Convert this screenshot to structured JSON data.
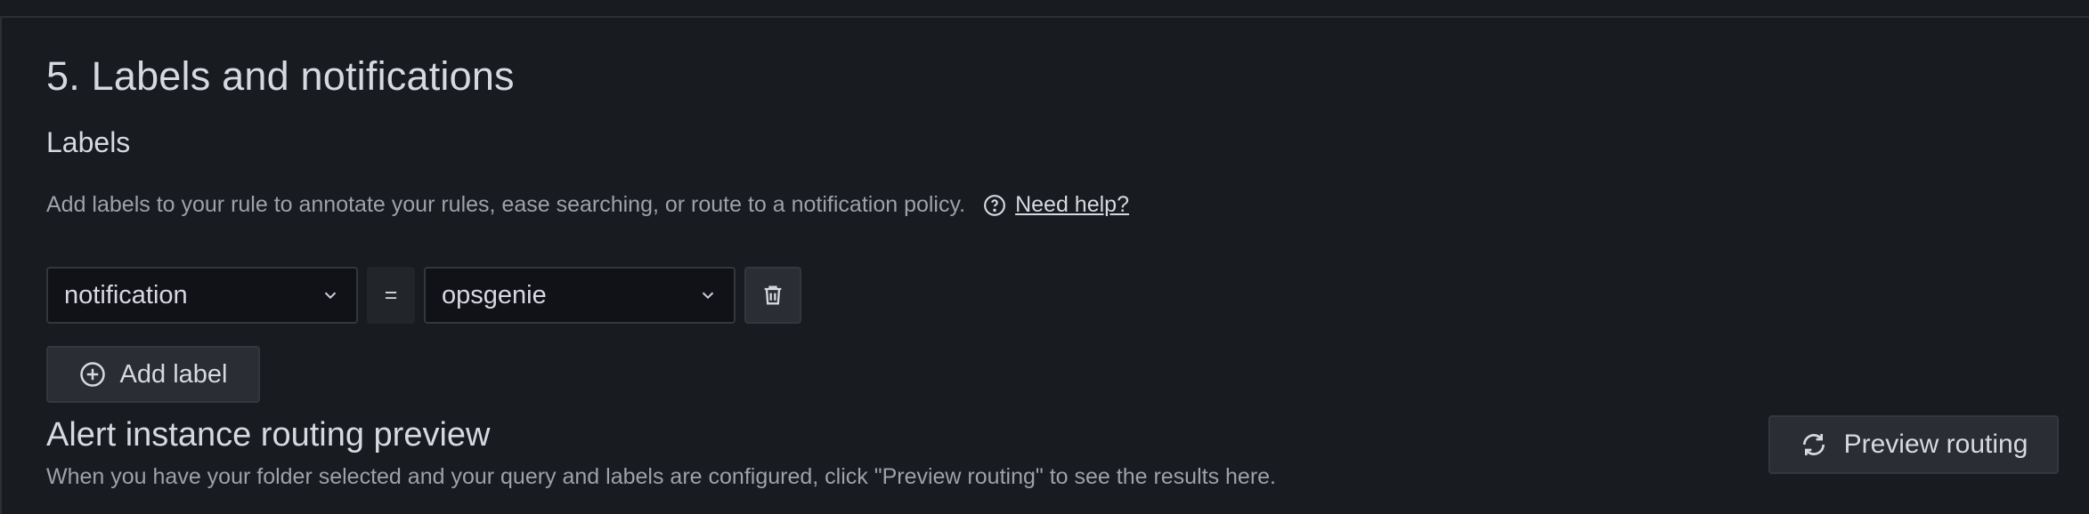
{
  "section": {
    "title": "5. Labels and notifications"
  },
  "labels": {
    "heading": "Labels",
    "description": "Add labels to your rule to annotate your rules, ease searching, or route to a notification policy.",
    "help_link": "Need help?",
    "help_icon": "question-circle-icon",
    "rows": [
      {
        "key": "notification",
        "operator": "=",
        "value": "opsgenie"
      }
    ],
    "delete_icon": "trash-icon",
    "add_label": "Add label",
    "add_icon": "plus-circle-icon"
  },
  "routing": {
    "title": "Alert instance routing preview",
    "description": "When you have your folder selected and your query and labels are configured, click \"Preview routing\" to see the results here.",
    "preview_button": "Preview routing",
    "preview_icon": "sync-icon"
  },
  "colors": {
    "background": "#181b1f",
    "input_bg": "#111217",
    "button_bg": "#2a2d33",
    "border": "#34373c",
    "text": "#d8d9e0",
    "muted_text": "#9fa1ab"
  }
}
